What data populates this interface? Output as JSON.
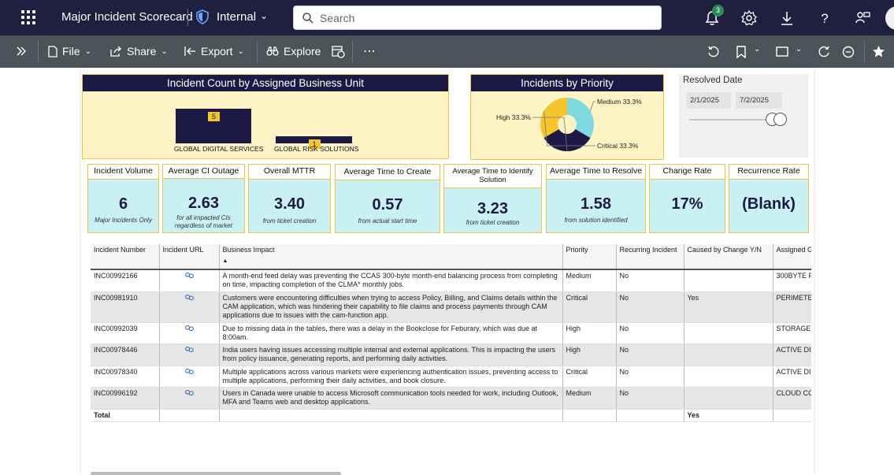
{
  "topbar": {
    "report_title": "Major Incident Scorecard",
    "sensitivity": "Internal",
    "search_placeholder": "Search",
    "notification_count": "3"
  },
  "toolbar": {
    "file": "File",
    "share": "Share",
    "export": "Export",
    "explore": "Explore"
  },
  "business_unit_chart": {
    "title": "Incident Count by Assigned Business Unit",
    "chart_data": {
      "type": "bar",
      "categories": [
        "GLOBAL DIGITAL SERVICES",
        "GLOBAL RISK SOLUTIONS"
      ],
      "values": [
        5,
        1
      ]
    }
  },
  "priority_chart": {
    "title": "Incidents by Priority",
    "chart_data": {
      "type": "pie",
      "categories": [
        "Medium",
        "High",
        "Critical"
      ],
      "values": [
        33.3,
        33.3,
        33.3
      ],
      "labels": [
        "Medium 33.3%",
        "High 33.3%",
        "Critical 33.3%"
      ],
      "colors": [
        "#7fd9e0",
        "#1c1944",
        "#f6c52e"
      ]
    }
  },
  "slicer": {
    "title": "Resolved Date",
    "start": "2/1/2025",
    "end": "7/2/2025"
  },
  "kpis": [
    {
      "label": "Incident Volume",
      "value": "6",
      "sub": "Major Incidents Only"
    },
    {
      "label": "Average CI Outage",
      "value": "2.63",
      "sub": "for all impacted CIs regardless of market"
    },
    {
      "label": "Overall MTTR",
      "value": "3.40",
      "sub": "from ticket creation"
    },
    {
      "label": "Average Time to Create",
      "value": "0.57",
      "sub": "from actual start time"
    },
    {
      "label": "Average Time to Identify Solution",
      "value": "3.23",
      "sub": "from ticket creation"
    },
    {
      "label": "Average Time to Resolve",
      "value": "1.58",
      "sub": "from solution identified"
    },
    {
      "label": "Change Rate",
      "value": "17%",
      "sub": ""
    },
    {
      "label": "Recurrence Rate",
      "value": "(Blank)",
      "sub": ""
    }
  ],
  "table": {
    "columns": [
      "Incident Number",
      "Incident URL",
      "Business Impact",
      "Priority",
      "Recurring Incident",
      "Caused by Change Y/N",
      "Assigned G"
    ],
    "sort_indicator": "▲",
    "rows": [
      {
        "number": "INC00992166",
        "impact": "A month-end feed delay was preventing the CCAS 300-byte month-end balancing process from completing on time, impacting completion of the CLMA* monthly jobs.",
        "priority": "Medium",
        "recurring": "No",
        "change": "",
        "group": "300BYTE F"
      },
      {
        "number": "INC00981910",
        "impact": "Customers were encountering difficulties when trying to access Policy, Billing, and Claims details within the CAM application, which was hindering their capability to file claims and process payments through CAM applications due to issues with the cam-function app.",
        "priority": "Critical",
        "recurring": "No",
        "change": "Yes",
        "group": "PERIMETE"
      },
      {
        "number": "INC00992039",
        "impact": "Due to missing data in the tables, there was a delay in the Bookclose for Feburary, which was due at 8:00am.",
        "priority": "High",
        "recurring": "No",
        "change": "",
        "group": "STORAGE"
      },
      {
        "number": "INC00978446",
        "impact": "India users having issues accessing multiple internal and external applications. This is impacting the users from policy issuance, generating reports, and performing daily activities.",
        "priority": "High",
        "recurring": "No",
        "change": "",
        "group": "ACTIVE DI"
      },
      {
        "number": "INC00978340",
        "impact": "Multiple applications across various markets were experiencing authentication issues, preventing access to multiple applications, performing their daily activities, and book closure.",
        "priority": "Critical",
        "recurring": "No",
        "change": "",
        "group": "ACTIVE DI"
      },
      {
        "number": "INC00996192",
        "impact": "Users in Canada were unable to access Microsoft communication tools needed for work, including Outlook, MFA and Teams web and desktop applications.",
        "priority": "Medium",
        "recurring": "No",
        "change": "",
        "group": "CLOUD CC"
      }
    ],
    "total_label": "Total",
    "total_change": "Yes"
  }
}
